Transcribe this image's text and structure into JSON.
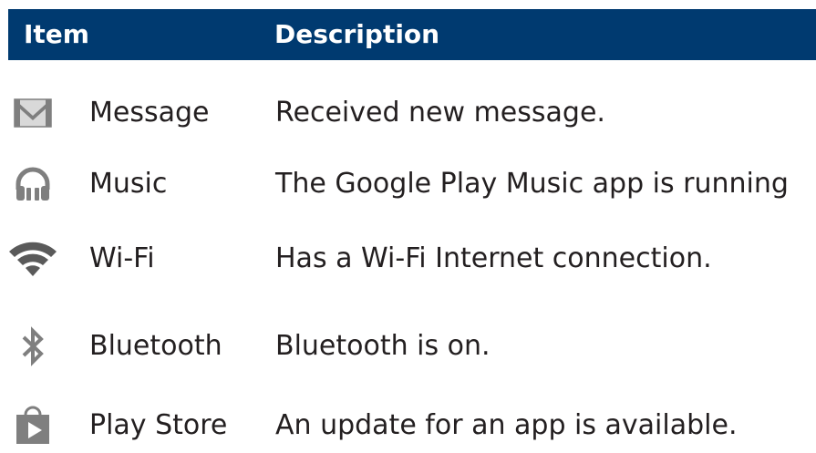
{
  "header": {
    "item_label": "Item",
    "description_label": "Description"
  },
  "rows": [
    {
      "icon": "gmail-envelope-icon",
      "item": "Message",
      "description": "Received new message."
    },
    {
      "icon": "headphones-icon",
      "item": "Music",
      "description": "The Google Play Music app is running"
    },
    {
      "icon": "wifi-icon",
      "item": "Wi-Fi",
      "description": "Has a Wi-Fi Internet connection."
    },
    {
      "icon": "bluetooth-icon",
      "item": "Bluetooth",
      "description": "Bluetooth is on."
    },
    {
      "icon": "play-store-bag-icon",
      "item": "Play Store",
      "description": "An update for an app is available."
    }
  ],
  "colors": {
    "header_bg": "#003a70",
    "header_text": "#ffffff",
    "body_text": "#231f20",
    "icon_gray": "#7f7f7f"
  }
}
